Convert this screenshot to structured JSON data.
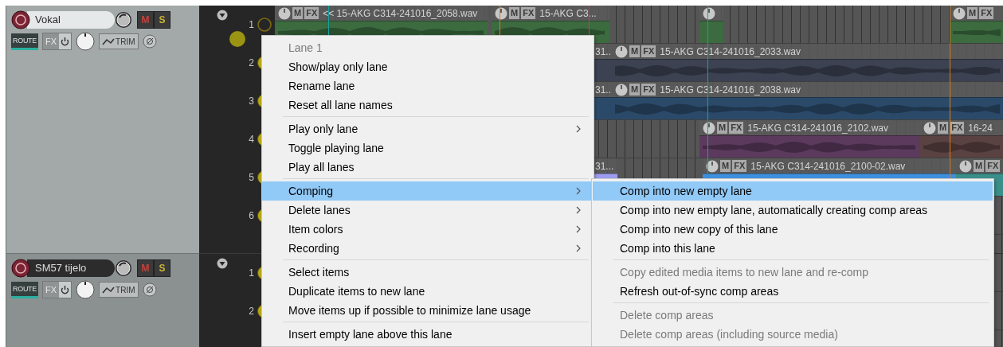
{
  "tracks": [
    {
      "name": "Vokal",
      "selected": true,
      "mute": "M",
      "solo": "S",
      "route": "ROUTE",
      "fx": "FX",
      "trim": "TRIM",
      "lanes": [
        {
          "number": "1",
          "playing": false,
          "items": [
            {
              "label": "<< 15-AKG C314-241016_2058.wav",
              "color": "#3b6b3f",
              "knob": true,
              "buttons": [
                "M",
                "FX"
              ]
            },
            {
              "label": "15-AKG C3...",
              "color": "#3b6b3f",
              "knob": true,
              "buttons": [
                "M",
                "FX"
              ]
            },
            {
              "color": "#3b6b3f",
              "knob": true
            },
            {
              "color": "#3b6b3f",
              "knob": true,
              "buttons": [
                "M",
                "FX"
              ]
            }
          ]
        },
        {
          "number": "2",
          "playing": true,
          "items": [
            {
              "label": "31...",
              "color": "#3c4252",
              "knob": false
            },
            {
              "label": "15-AKG C314-241016_2033.wav",
              "color": "#3c4252",
              "knob": true,
              "buttons": [
                "M",
                "FX"
              ]
            }
          ]
        },
        {
          "number": "3",
          "playing": true,
          "items": [
            {
              "label": "31...",
              "color": "#2b4a6a",
              "knob": false
            },
            {
              "label": "15-AKG C314-241016_2038.wav",
              "color": "#2b4a6a",
              "knob": true,
              "buttons": [
                "M",
                "FX"
              ]
            }
          ]
        },
        {
          "number": "4",
          "playing": true,
          "items": [
            {
              "label": "15-AKG C314-241016_2102.wav",
              "color": "#5b3a5e",
              "knob": true,
              "buttons": [
                "M",
                "FX"
              ]
            },
            {
              "label": "16-24",
              "color": "#5a4242",
              "knob": true,
              "buttons": [
                "M",
                "FX"
              ]
            }
          ]
        },
        {
          "number": "5",
          "playing": true,
          "items": [
            {
              "label": "31...",
              "color": "#9d9cf0",
              "knob": false
            },
            {
              "label": "15-AKG C314-241016_2100-02.wav",
              "color": "#3f8fdf",
              "knob": true,
              "buttons": [
                "M",
                "FX"
              ]
            },
            {
              "color": "#3a8f8a",
              "knob": true,
              "buttons": [
                "M",
                "FX"
              ]
            }
          ]
        },
        {
          "number": "6",
          "playing": true
        }
      ]
    },
    {
      "name": "SM57 tijelo",
      "selected": false,
      "mute": "M",
      "solo": "S",
      "route": "ROUTE",
      "fx": "FX",
      "trim": "TRIM",
      "lanes": [
        {
          "number": "1",
          "playing": true
        },
        {
          "number": "2",
          "playing": true
        }
      ]
    }
  ],
  "context_menu": {
    "groups": [
      [
        {
          "label": "Lane 1",
          "disabled": true,
          "submenu": false,
          "selected": false
        },
        {
          "label": "Show/play only lane",
          "disabled": false,
          "submenu": false,
          "selected": false
        },
        {
          "label": "Rename lane",
          "disabled": false,
          "submenu": false,
          "selected": false
        },
        {
          "label": "Reset all lane names",
          "disabled": false,
          "submenu": false,
          "selected": false
        }
      ],
      [
        {
          "label": "Play only lane",
          "disabled": false,
          "submenu": true,
          "selected": false
        },
        {
          "label": "Toggle playing lane",
          "disabled": false,
          "submenu": false,
          "selected": false
        },
        {
          "label": "Play all lanes",
          "disabled": false,
          "submenu": false,
          "selected": false
        }
      ],
      [
        {
          "label": "Comping",
          "disabled": false,
          "submenu": true,
          "selected": true
        },
        {
          "label": "Delete lanes",
          "disabled": false,
          "submenu": true,
          "selected": false
        },
        {
          "label": "Item colors",
          "disabled": false,
          "submenu": true,
          "selected": false
        },
        {
          "label": "Recording",
          "disabled": false,
          "submenu": true,
          "selected": false
        }
      ],
      [
        {
          "label": "Select items",
          "disabled": false,
          "submenu": false,
          "selected": false
        },
        {
          "label": "Duplicate items to new lane",
          "disabled": false,
          "submenu": false,
          "selected": false
        },
        {
          "label": "Move items up if possible to minimize lane usage",
          "disabled": false,
          "submenu": false,
          "selected": false
        }
      ],
      [
        {
          "label": "Insert empty lane above this lane",
          "disabled": false,
          "submenu": false,
          "selected": false
        }
      ]
    ]
  },
  "submenu": {
    "groups": [
      [
        {
          "label": "Comp into new empty lane",
          "disabled": false,
          "selected": true
        },
        {
          "label": "Comp into new empty lane, automatically creating comp areas",
          "disabled": false,
          "selected": false
        },
        {
          "label": "Comp into new copy of this lane",
          "disabled": false,
          "selected": false
        },
        {
          "label": "Comp into this lane",
          "disabled": false,
          "selected": false
        }
      ],
      [
        {
          "label": "Copy edited media items to new lane and re-comp",
          "disabled": true,
          "selected": false
        },
        {
          "label": "Refresh out-of-sync comp areas",
          "disabled": false,
          "selected": false
        }
      ],
      [
        {
          "label": "Delete comp areas",
          "disabled": true,
          "selected": false
        },
        {
          "label": "Delete comp areas (including source media)",
          "disabled": true,
          "selected": false
        }
      ]
    ]
  }
}
